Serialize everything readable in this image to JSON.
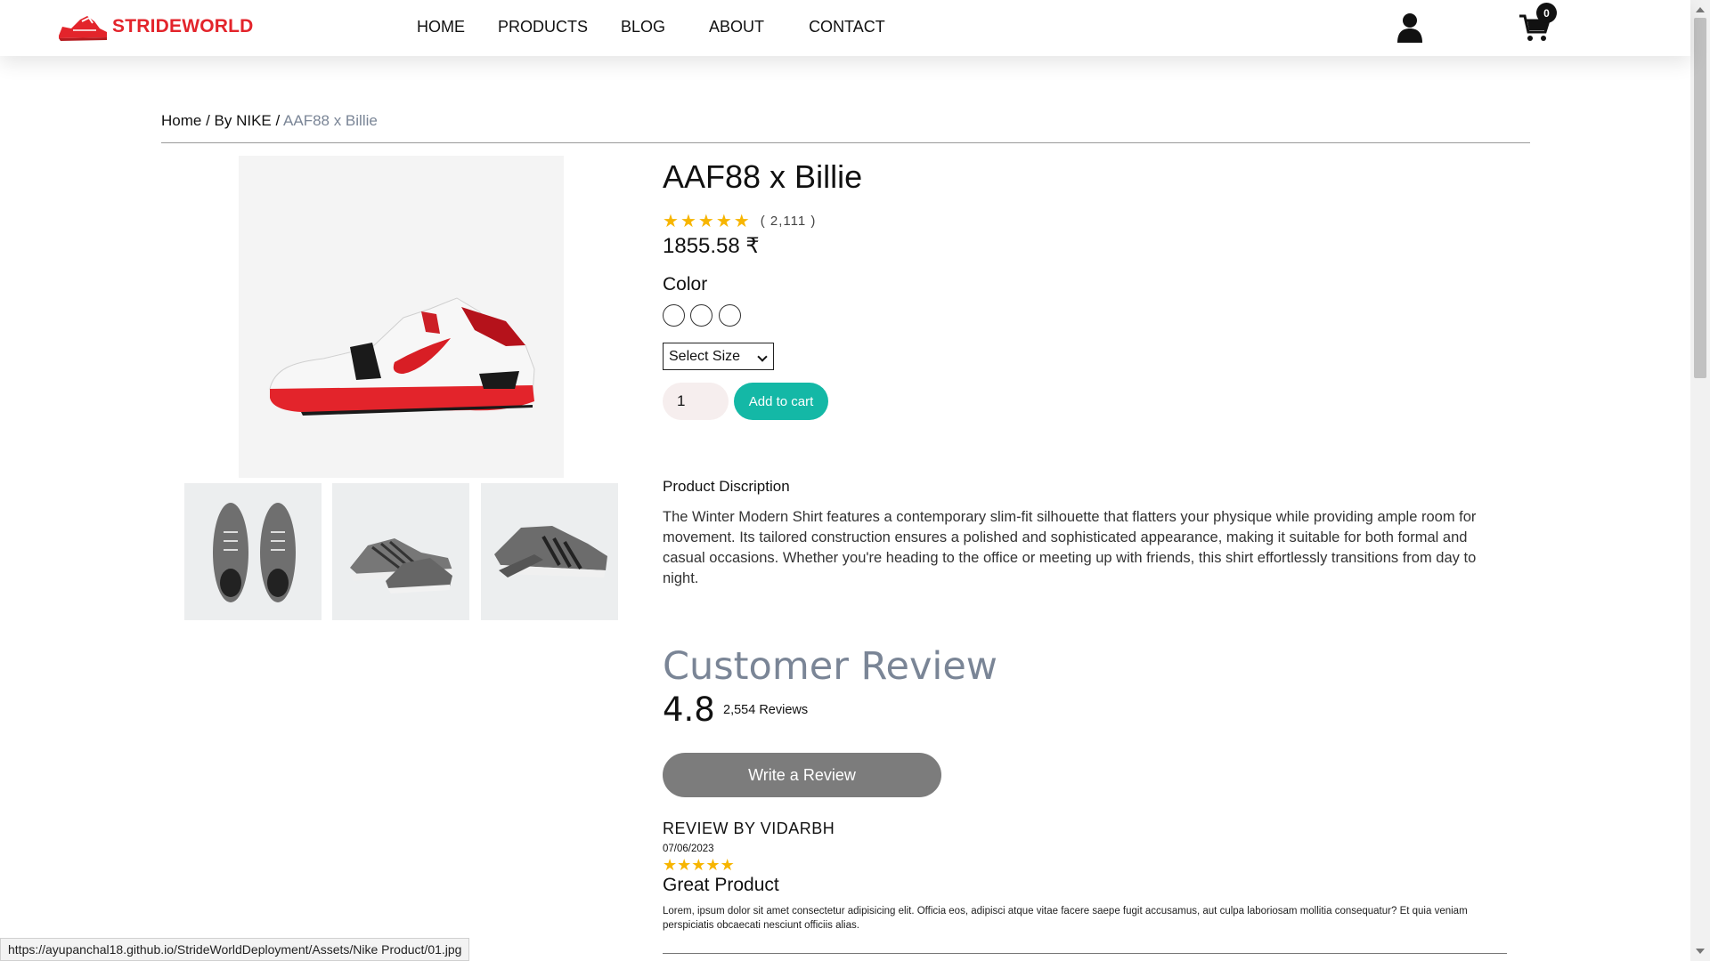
{
  "brand": {
    "name": "STRIDEWORLD",
    "color": "#e3242b"
  },
  "nav": {
    "links": [
      "HOME",
      "PRODUCTS",
      "BLOG",
      "ABOUT",
      "CONTACT"
    ],
    "cart_count": "0"
  },
  "breadcrumb": {
    "home": "Home /",
    "brand": "By  NIKE /",
    "current": "AAF88 x  Billie"
  },
  "product": {
    "title": "AAF88 x  Billie",
    "rating_count": "( 2,111 )",
    "stars": 5,
    "price": "1855.58 ₹",
    "color_label": "Color",
    "size_placeholder": "Select Size",
    "quantity": "1",
    "add_to_cart": "Add to cart",
    "description_title": "Product Discription",
    "description": "The Winter  Modern Shirt features a contemporary slim-fit silhouette that flatters your physique while providing ample room for movement.  Its tailored construction ensures a polished and sophisticated appearance, making it suitable for both formal and casual occasions. Whether you're heading to the office or meeting up with friends, this shirt effortlessly transitions from day to night."
  },
  "reviews": {
    "heading": "Customer Review",
    "average": "4.8",
    "count": "2,554 Reviews",
    "write_button": "Write a  Review",
    "items": [
      {
        "author": "REVIEW BY VIDARBH",
        "date": "07/06/2023",
        "stars": 5,
        "title": "Great Product",
        "body": "Lorem, ipsum dolor sit amet consectetur adipisicing elit. Officia eos, adipisci atque vitae facere saepe fugit accusamus, aut culpa laboriosam mollitia consequatur?  Et quia veniam perspiciatis obcaecati nesciunt officiis alias."
      }
    ]
  },
  "status_bar": {
    "url": "https://ayupanchal18.github.io/StrideWorldDeployment/Assets/Nike Product/01.jpg"
  },
  "colors": {
    "accent_teal": "#14b8a6",
    "star": "#f7b500",
    "muted": "#7a8596",
    "review_button": "#7c7c7c"
  },
  "icons": [
    "sneaker-logo-icon",
    "user-icon",
    "cart-icon",
    "star-icon",
    "chevron-down-icon"
  ]
}
